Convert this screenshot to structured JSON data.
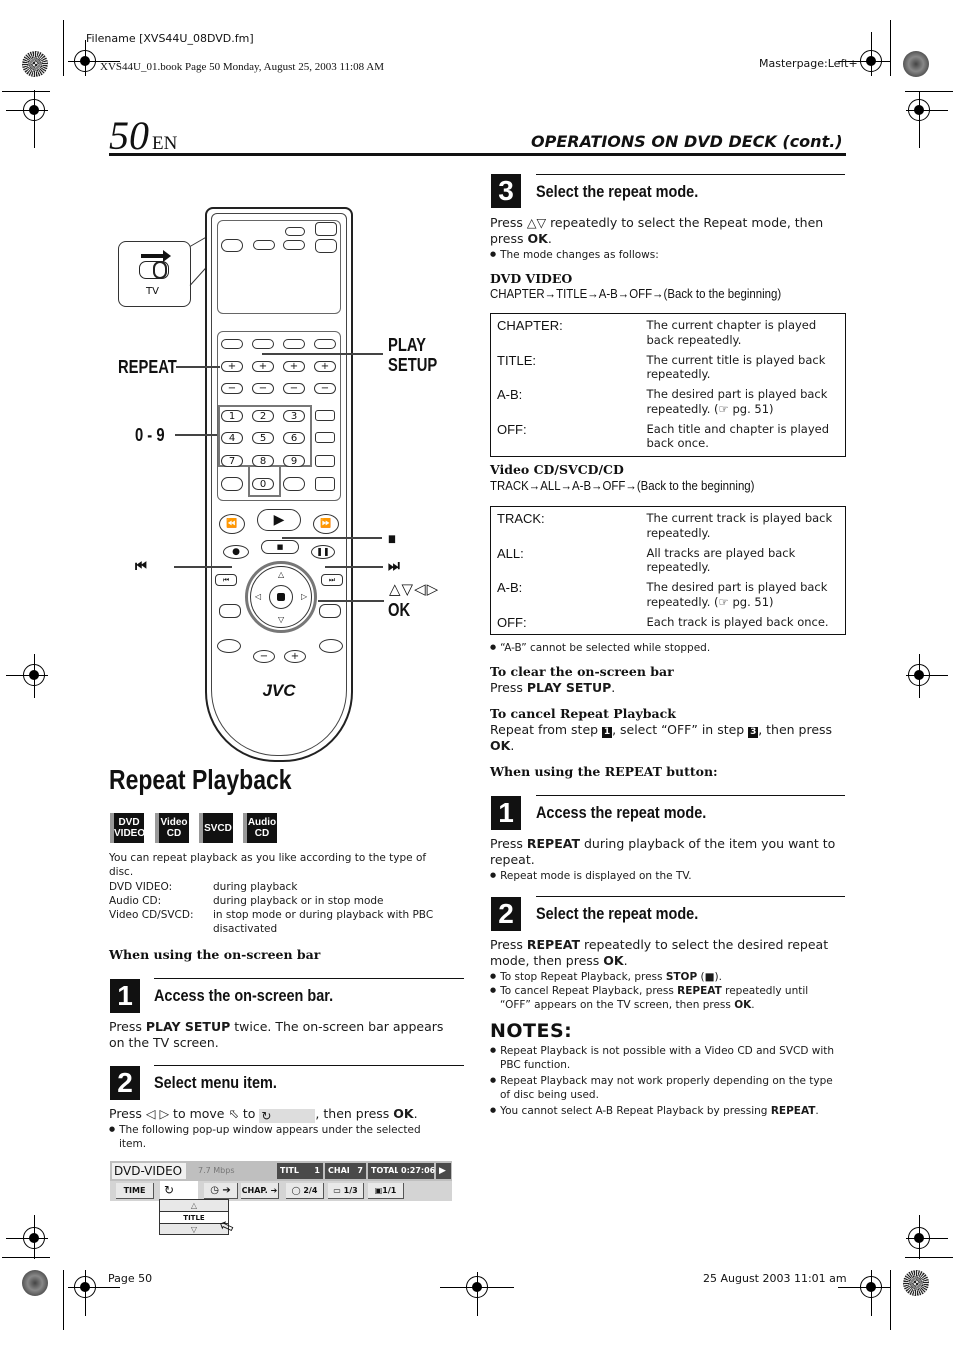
{
  "print_meta": {
    "filename": "Filename [XVS44U_08DVD.fm]",
    "book_line": "XVS44U_01.book  Page 50  Monday, August 25, 2003  11:08 AM",
    "masterpage": "Masterpage:Left+",
    "footer_page": "Page 50",
    "footer_date": "25 August 2003 11:01 am"
  },
  "header": {
    "page_number": "50",
    "lang": "EN",
    "section": "OPERATIONS ON DVD DECK (cont.)"
  },
  "remote": {
    "brand": "JVC",
    "switch_label": "TV",
    "numpad": [
      "1",
      "2",
      "3",
      "4",
      "5",
      "6",
      "7",
      "8",
      "9",
      "0"
    ],
    "callouts": {
      "repeat": "REPEAT",
      "play_setup_1": "PLAY",
      "play_setup_2": "SETUP",
      "digits": "0 - 9",
      "stop": "■",
      "prev": "⏮",
      "next": "⏭",
      "arrows": "△▽◁▷",
      "ok": "OK"
    }
  },
  "left": {
    "title": "Repeat Playback",
    "badges": [
      {
        "line1": "DVD",
        "line2": "VIDEO"
      },
      {
        "line1": "Video",
        "line2": "CD"
      },
      {
        "line1": "SVCD",
        "line2": ""
      },
      {
        "line1": "Audio",
        "line2": "CD"
      }
    ],
    "intro": "You can repeat playback as you like according to the type of disc.",
    "disc_rows": [
      {
        "k": "DVD VIDEO:",
        "v": "during playback"
      },
      {
        "k": "Audio CD:",
        "v": "during playback or in stop mode"
      },
      {
        "k": "Video CD/SVCD:",
        "v": "in stop mode or during playback with PBC disactivated"
      }
    ],
    "onscreen_heading": "When using the on-screen bar",
    "step1": {
      "num": "1",
      "title": "Access the on-screen bar.",
      "text_pre": "Press ",
      "text_bold": "PLAY SETUP",
      "text_post": " twice. The on-screen bar appears on the TV screen."
    },
    "step2": {
      "num": "2",
      "title": "Select menu item.",
      "text_a": "Press ◁ ▷ to move ⬁ to ",
      "text_b": ", then press ",
      "text_bold": "OK",
      "text_end": ".",
      "bullet": "The following pop-up window appears under the selected item."
    }
  },
  "osd": {
    "disc": "DVD-VIDEO",
    "rate": "7.7 Mbps",
    "title_label": "TITLE",
    "title_val": "1",
    "chap_label": "CHAP",
    "chap_val": "7",
    "total_label": "TOTAL",
    "total_val": "0:27:06",
    "play": "▶",
    "time_btn": "TIME",
    "repeat_icon": "↻",
    "clock_btn": "◷ ➔",
    "chap_btn": "CHAP. ➔",
    "audio_val": "2/4",
    "subtitle_val": "1/3",
    "angle_val": "1/1",
    "popup_up": "△",
    "popup_value": "TITLE",
    "popup_down": "▽"
  },
  "right": {
    "step3": {
      "num": "3",
      "title": "Select the repeat mode.",
      "text_pre": "Press △▽ repeatedly to select the Repeat mode, then press ",
      "text_bold": "OK",
      "text_end": ".",
      "bullet": "The mode changes as follows:"
    },
    "dvd": {
      "heading": "DVD VIDEO",
      "sequence": "CHAPTER→TITLE→A-B→OFF→(Back to the beginning)",
      "rows": [
        {
          "k": "CHAPTER:",
          "v": "The current chapter is played back repeatedly."
        },
        {
          "k": "TITLE:",
          "v": "The current title is played back repeatedly."
        },
        {
          "k": "A-B:",
          "v": "The desired part is played back repeatedly. (☞ pg. 51)"
        },
        {
          "k": "OFF:",
          "v": "Each title and chapter is played back once."
        }
      ]
    },
    "vcd": {
      "heading": "Video CD/SVCD/CD",
      "sequence": "TRACK→ALL→A-B→OFF→(Back to the beginning)",
      "rows": [
        {
          "k": "TRACK:",
          "v": "The current track is played back repeatedly."
        },
        {
          "k": "ALL:",
          "v": "All tracks are played back repeatedly."
        },
        {
          "k": "A-B:",
          "v": "The desired part is played back repeatedly. (☞ pg. 51)"
        },
        {
          "k": "OFF:",
          "v": "Each track is played back once."
        }
      ]
    },
    "ab_note": "“A-B” cannot be selected while stopped.",
    "clear": {
      "heading": "To clear the on-screen bar",
      "text_pre": "Press ",
      "text_bold": "PLAY SETUP",
      "text_end": "."
    },
    "cancel": {
      "heading": "To cancel Repeat Playback",
      "text_a": "Repeat from step ",
      "step_a": "1",
      "text_b": ", select “OFF” in step ",
      "step_b": "3",
      "text_c": ", then press ",
      "text_bold": "OK",
      "text_end": "."
    },
    "repeat_btn_heading": "When using the REPEAT button:",
    "rstep1": {
      "num": "1",
      "title": "Access the repeat mode.",
      "text_pre": "Press ",
      "text_bold": "REPEAT",
      "text_post": " during playback of the item you want to repeat.",
      "bullet": "Repeat mode is displayed on the TV."
    },
    "rstep2": {
      "num": "2",
      "title": "Select the repeat mode.",
      "text_pre": "Press ",
      "text_bold": "REPEAT",
      "text_mid": " repeatedly to select the desired repeat mode, then press ",
      "text_bold2": "OK",
      "text_end": ".",
      "b1_pre": "To stop Repeat Playback, press ",
      "b1_bold": "STOP",
      "b1_post": " (■).",
      "b2_pre": "To cancel Repeat Playback, press ",
      "b2_bold": "REPEAT",
      "b2_mid": " repeatedly until “OFF” appears on the TV screen, then press ",
      "b2_bold2": "OK",
      "b2_end": "."
    },
    "notes": {
      "title": "NOTES:",
      "items": [
        {
          "pre": "Repeat Playback is not possible with a Video CD and SVCD with PBC function.",
          "bold": "",
          "post": ""
        },
        {
          "pre": "Repeat Playback may not work properly depending on the type of disc being used.",
          "bold": "",
          "post": ""
        },
        {
          "pre": "You cannot select A-B Repeat Playback by pressing ",
          "bold": "REPEAT",
          "post": "."
        }
      ]
    }
  }
}
